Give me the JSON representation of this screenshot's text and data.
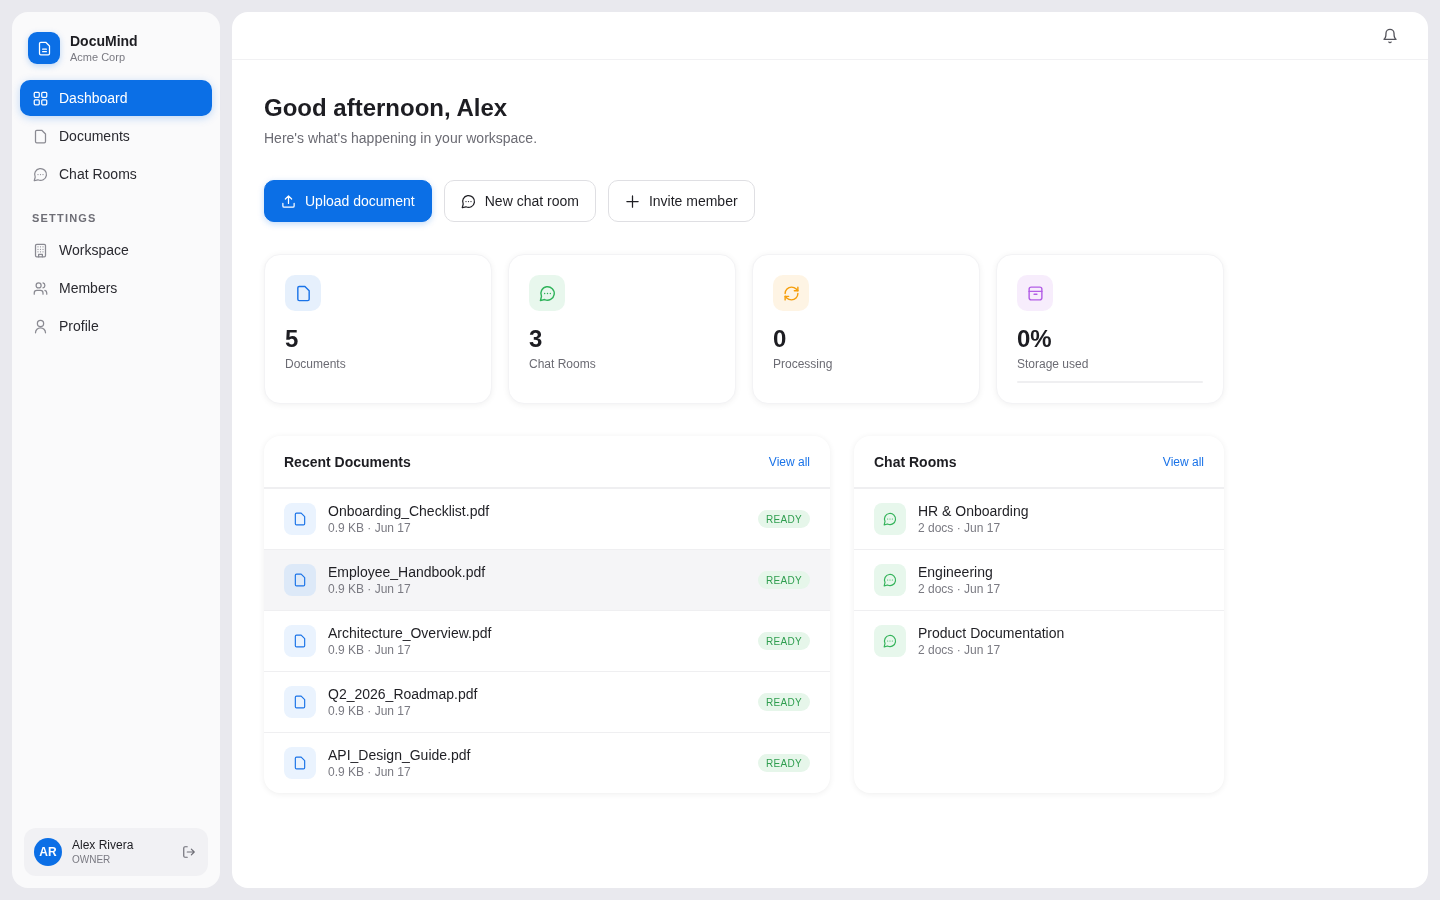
{
  "sidebar": {
    "brand": {
      "name": "DocuMind",
      "org": "Acme Corp"
    },
    "nav": [
      {
        "label": "Dashboard",
        "selected": true
      },
      {
        "label": "Documents",
        "selected": false
      },
      {
        "label": "Chat Rooms",
        "selected": false
      }
    ],
    "settings": {
      "heading": "SETTINGS",
      "items": [
        {
          "label": "Workspace",
          "selected": false
        },
        {
          "label": "Members",
          "selected": false
        },
        {
          "label": "Profile",
          "selected": false
        }
      ]
    },
    "user": {
      "initials": "AR",
      "name": "Alex Rivera",
      "role": "OWNER"
    }
  },
  "main": {
    "greeting": "Good afternoon, Alex",
    "subtitle": "Here's what's happening in your workspace.",
    "actions": [
      {
        "label": "Upload document",
        "kind": "primary"
      },
      {
        "label": "New chat room",
        "kind": "secondary"
      },
      {
        "label": "Invite member",
        "kind": "secondary"
      }
    ],
    "stats": [
      {
        "value": "5",
        "label": "Documents",
        "color": "#1a73e8"
      },
      {
        "value": "3",
        "label": "Chat Rooms",
        "color": "#2fb35a"
      },
      {
        "value": "0",
        "label": "Processing",
        "color": "#f59e0b"
      },
      {
        "value": "0%",
        "label": "Storage used",
        "color": "#b35ee6",
        "level": 0
      }
    ],
    "recent_documents": {
      "title": "Recent Documents",
      "link": "View all",
      "rows": [
        {
          "name": "Onboarding_Checklist.pdf",
          "meta": "0.9 KB · Jun 17",
          "status": "READY",
          "highlighted": false
        },
        {
          "name": "Employee_Handbook.pdf",
          "meta": "0.9 KB · Jun 17",
          "status": "READY",
          "highlighted": true
        },
        {
          "name": "Architecture_Overview.pdf",
          "meta": "0.9 KB · Jun 17",
          "status": "READY",
          "highlighted": false
        },
        {
          "name": "Q2_2026_Roadmap.pdf",
          "meta": "0.9 KB · Jun 17",
          "status": "READY",
          "highlighted": false
        },
        {
          "name": "API_Design_Guide.pdf",
          "meta": "0.9 KB · Jun 17",
          "status": "READY",
          "highlighted": false
        }
      ]
    },
    "chat_rooms": {
      "title": "Chat Rooms",
      "link": "View all",
      "rows": [
        {
          "name": "HR & Onboarding",
          "meta": "2 docs · Jun 17"
        },
        {
          "name": "Engineering",
          "meta": "2 docs · Jun 17"
        },
        {
          "name": "Product Documentation",
          "meta": "2 docs · Jun 17"
        }
      ]
    }
  }
}
